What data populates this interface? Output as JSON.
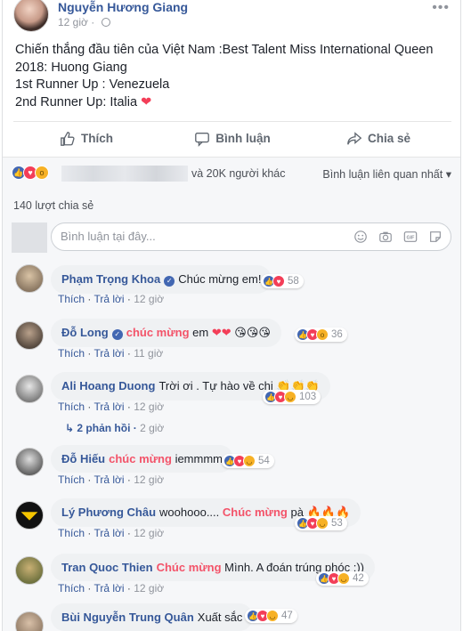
{
  "post": {
    "author": "Nguyễn Hương Giang",
    "time": "12 giờ",
    "text_lines": [
      "Chiến thắng đầu tiên của Việt Nam :Best Talent Miss International Queen",
      "2018: Huong Giang",
      "1st Runner Up : Venezuela",
      "2nd Runner Up: Italia"
    ]
  },
  "actions": {
    "like": "Thích",
    "comment": "Bình luận",
    "share": "Chia sẻ"
  },
  "stats": {
    "others": "và 20K người khác",
    "sort": "Bình luận liên quan nhất",
    "shares": "140 lượt chia sẻ"
  },
  "composer": {
    "placeholder": "Bình luận tại đây..."
  },
  "comment_actions": {
    "like": "Thích",
    "reply": "Trả lời"
  },
  "comments": [
    {
      "name": "Phạm Trọng Khoa",
      "verified": true,
      "tag": "",
      "text": "Chúc mừng em!",
      "reactions": "58",
      "time": "12 giờ"
    },
    {
      "name": "Đỗ Long",
      "verified": true,
      "tag": "chúc mừng",
      "text": "em",
      "reactions": "36",
      "time": "11 giờ"
    },
    {
      "name": "Ali Hoang Duong",
      "verified": false,
      "tag": "",
      "text": "Trời ơi . Tự hào về chị",
      "reactions": "103",
      "time": "12 giờ",
      "replies": "2 phản hồi",
      "replies_time": "2 giờ"
    },
    {
      "name": "Đỗ Hiếu",
      "verified": false,
      "tag": "chúc mừng",
      "text": "iemmmm",
      "reactions": "54",
      "time": "12 giờ"
    },
    {
      "name": "Lý Phương Châu",
      "verified": false,
      "tag": "",
      "text_pre": "woohooo....",
      "tag2": "Chúc mừng",
      "text": "pà",
      "reactions": "53",
      "time": "12 giờ"
    },
    {
      "name": "Tran Quoc Thien",
      "verified": false,
      "tag": "Chúc mừng",
      "text": "Mình. A đoán trúng phóc :))",
      "reactions": "42",
      "time": "12 giờ"
    },
    {
      "name": "Bùi Nguyễn Trung Quân",
      "verified": false,
      "tag": "",
      "text": "Xuất sắc",
      "reactions": "47",
      "time": ""
    }
  ],
  "colors": {
    "link": "#365899",
    "tag": "#f35369",
    "like": "#4267b2",
    "love": "#f33e58",
    "haha": "#f7b125"
  }
}
